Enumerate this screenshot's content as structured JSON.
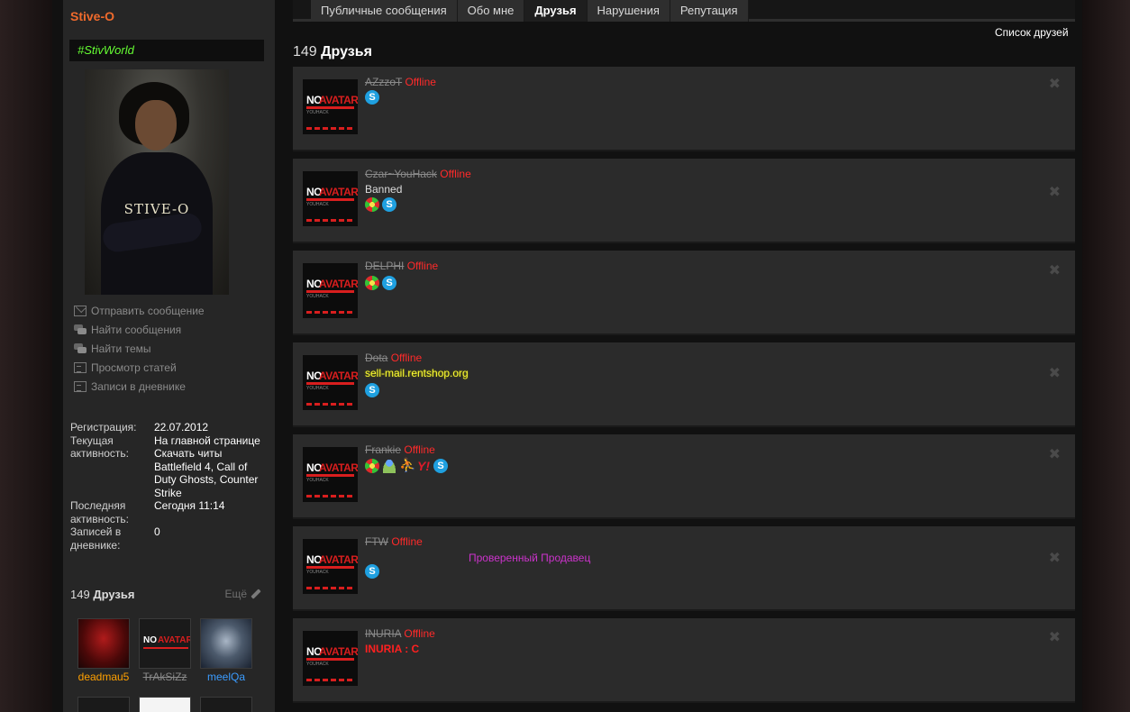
{
  "profile": {
    "username": "Stive-O",
    "user_title": "#StivWorld",
    "avatar_text": "STIVE-O",
    "actions": [
      {
        "label": "Отправить сообщение",
        "icon": "mail-icon"
      },
      {
        "label": "Найти сообщения",
        "icon": "chat-icon"
      },
      {
        "label": "Найти темы",
        "icon": "chat-icon"
      },
      {
        "label": "Просмотр статей",
        "icon": "document-icon"
      },
      {
        "label": "Записи в дневнике",
        "icon": "document-icon"
      }
    ],
    "info": {
      "reg_label": "Регистрация:",
      "reg_value": "22.07.2012",
      "current_label": "Текущая активность:",
      "current_value": "На главной странице Скачать читы Battlefield 4, Call of Duty Ghosts, Counter Strike",
      "last_label": "Последняя активность:",
      "last_value": "Сегодня 11:14",
      "diary_label": "Записей в дневнике:",
      "diary_value": "0"
    },
    "side_friends": {
      "count": "149",
      "label": "Друзья",
      "more": "Ещё",
      "items": [
        {
          "name": "deadmau5",
          "color": "#ffa000"
        },
        {
          "name": "TrAkSiZz",
          "color": "#8a8a8a"
        },
        {
          "name": "meelQa",
          "color": "#3b9cff"
        }
      ]
    }
  },
  "tabs": [
    {
      "label": "Публичные сообщения"
    },
    {
      "label": "Обо мне"
    },
    {
      "label": "Друзья"
    },
    {
      "label": "Нарушения"
    },
    {
      "label": "Репутация"
    }
  ],
  "list_link": "Список друзей",
  "heading": {
    "count": "149",
    "label": "Друзья"
  },
  "avatar_placeholder": {
    "no": "NO",
    "avatar": "AVATAR",
    "sub": "YOUHACK"
  },
  "friends": [
    {
      "name": "AZzzoT",
      "status": "Offline",
      "extra": "",
      "extra_color": "",
      "icons": [
        "skype-icon"
      ]
    },
    {
      "name": "Czar~YouHack",
      "status": "Offline",
      "extra": "Banned",
      "extra_color": "#dcdcdc",
      "icons": [
        "icq-icon",
        "skype-icon"
      ]
    },
    {
      "name": "DELPHI",
      "status": "Offline",
      "extra": "",
      "extra_color": "",
      "icons": [
        "icq-icon",
        "skype-icon"
      ]
    },
    {
      "name": "Dota",
      "status": "Offline",
      "extra": "sell-mail.rentshop.org",
      "extra_color": "#ffff33",
      "icons": [
        "skype-icon"
      ]
    },
    {
      "name": "Frankie",
      "status": "Offline",
      "extra": "",
      "extra_color": "",
      "icons": [
        "icq-icon",
        "msn-icon",
        "aim-icon",
        "yahoo-icon",
        "skype-icon"
      ]
    },
    {
      "name": "FTW",
      "status": "Offline",
      "extra": "Проверенный Продавец",
      "extra_color": "#cc33cc",
      "icons": [
        "skype-icon"
      ]
    },
    {
      "name": "INURIA",
      "status": "Offline",
      "extra": "INURIA : C",
      "extra_color": "#ff2020",
      "icons": []
    }
  ]
}
